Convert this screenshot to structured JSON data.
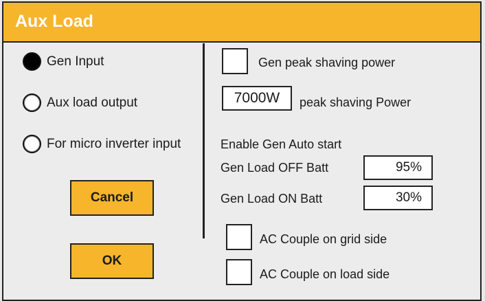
{
  "window": {
    "title": "Aux Load"
  },
  "mode": {
    "options": [
      {
        "label": "Gen Input",
        "selected": true
      },
      {
        "label": "Aux load output",
        "selected": false
      },
      {
        "label": "For micro inverter input",
        "selected": false
      }
    ]
  },
  "buttons": {
    "cancel": "Cancel",
    "ok": "OK"
  },
  "settings": {
    "gen_peak_shaving": {
      "label": "Gen peak shaving power",
      "checked": false
    },
    "peak_power": {
      "value": "7000W",
      "label": "peak shaving Power"
    },
    "auto_start_heading": "Enable Gen Auto start",
    "load_off": {
      "label": "Gen Load OFF Batt",
      "value": "95%"
    },
    "load_on": {
      "label": "Gen Load ON Batt",
      "value": "30%"
    },
    "ac_couple_grid": {
      "label": "AC Couple on grid side",
      "checked": false
    },
    "ac_couple_load": {
      "label": "AC Couple on load side",
      "checked": false
    }
  },
  "colors": {
    "accent": "#f7b52b",
    "background": "#ececec",
    "border": "#222222"
  }
}
